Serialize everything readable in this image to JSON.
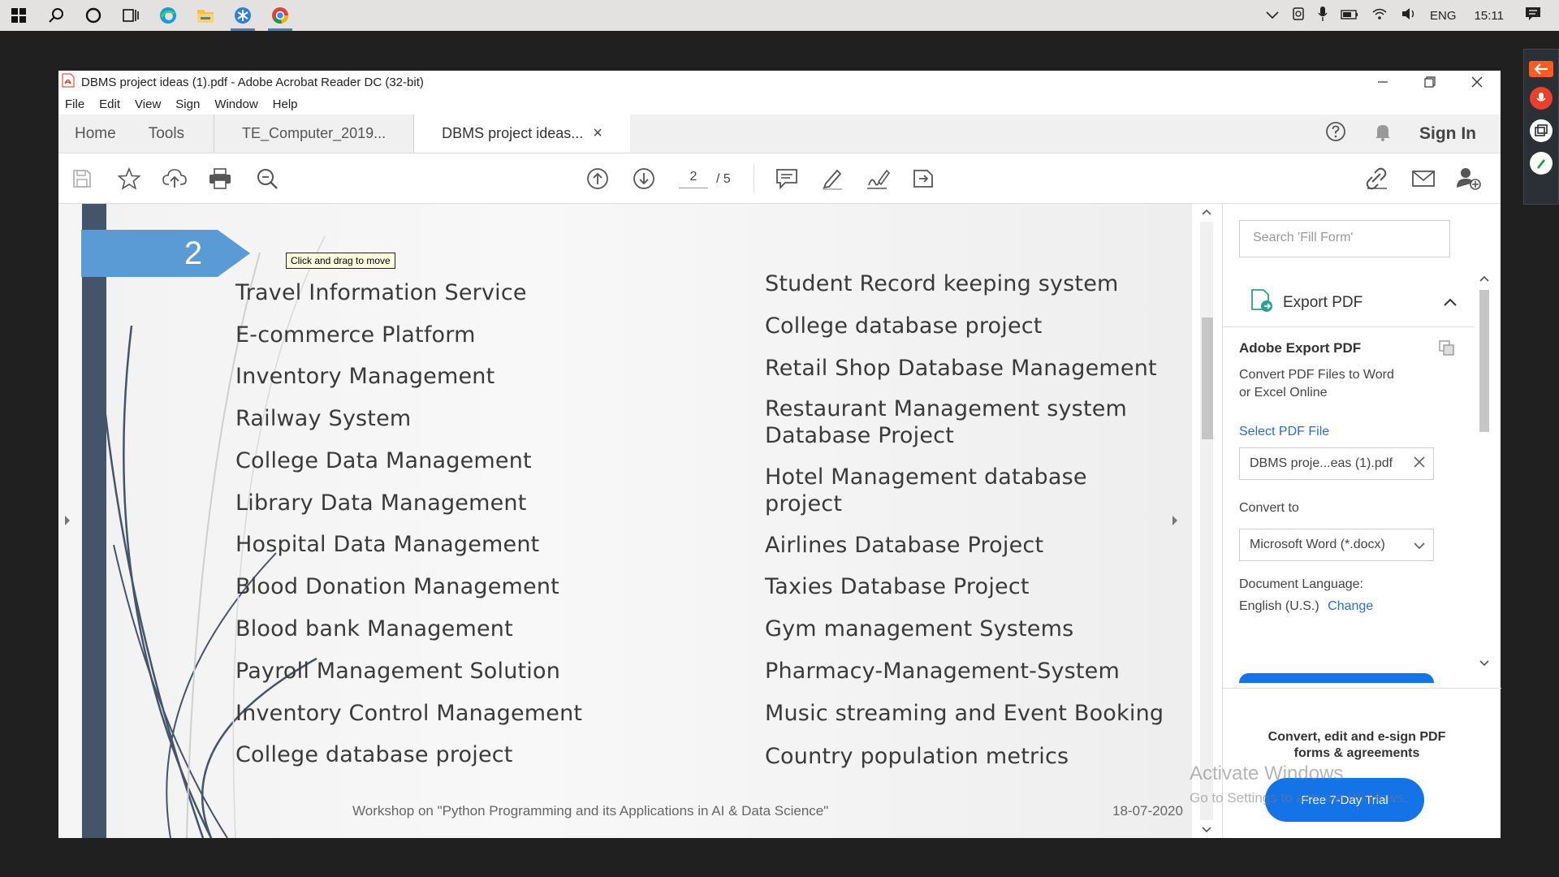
{
  "taskbar": {
    "lang": "ENG",
    "time": "15:11"
  },
  "window": {
    "title": "DBMS project ideas (1).pdf - Adobe Acrobat Reader DC (32-bit)",
    "menu": [
      "File",
      "Edit",
      "View",
      "Sign",
      "Window",
      "Help"
    ],
    "tabs": {
      "home": "Home",
      "tools": "Tools",
      "doc1": "TE_Computer_2019...",
      "doc2": "DBMS project ideas...",
      "close": "×",
      "sign_in": "Sign In"
    },
    "toolbar": {
      "page_current": "2",
      "page_total": "/ 5"
    }
  },
  "document": {
    "slide_number": "2",
    "hint": "Click and drag to move",
    "left_items": [
      "Travel Information Service",
      "E-commerce Platform",
      "Inventory Management",
      "Railway System",
      "College Data Management",
      "Library Data Management",
      "Hospital Data Management",
      "Blood Donation Management",
      "Blood bank Management",
      "Payroll Management Solution",
      "Inventory Control Management",
      "College database project"
    ],
    "right_items": [
      "Student Record keeping system",
      "College database project",
      "Retail Shop Database Management",
      "Restaurant Management system",
      "Database Project",
      "Hotel Management database",
      "project",
      "Airlines Database Project",
      "Taxies Database Project",
      "Gym management Systems",
      "Pharmacy-Management-System",
      "Music streaming and Event Booking",
      "Country population metrics"
    ],
    "footer_left": "Workshop on \"Python Programming and its Applications in AI & Data Science\"",
    "footer_right": "18-07-2020"
  },
  "right_pane": {
    "search_placeholder": "Search 'Fill Form'",
    "export_title": "Export PDF",
    "adobe_export": "Adobe Export PDF",
    "desc_line1": "Convert PDF Files to Word",
    "desc_line2": "or Excel Online",
    "select_file": "Select PDF File",
    "file_name": "DBMS proje...eas (1).pdf",
    "convert_to": "Convert to",
    "format": "Microsoft Word (*.docx)",
    "doc_lang_label": "Document Language:",
    "doc_lang_value": "English (U.S.)",
    "change": "Change",
    "promo_line1": "Convert, edit and e-sign PDF",
    "promo_line2": "forms & agreements",
    "trial_button": "Free 7-Day Trial"
  },
  "watermark": {
    "line1": "Activate Windows",
    "line2": "Go to Settings to activate Windows."
  },
  "colors": {
    "accent_blue": "#1473e6",
    "slide_band": "#44546a",
    "badge_blue": "#5b9bd5"
  }
}
